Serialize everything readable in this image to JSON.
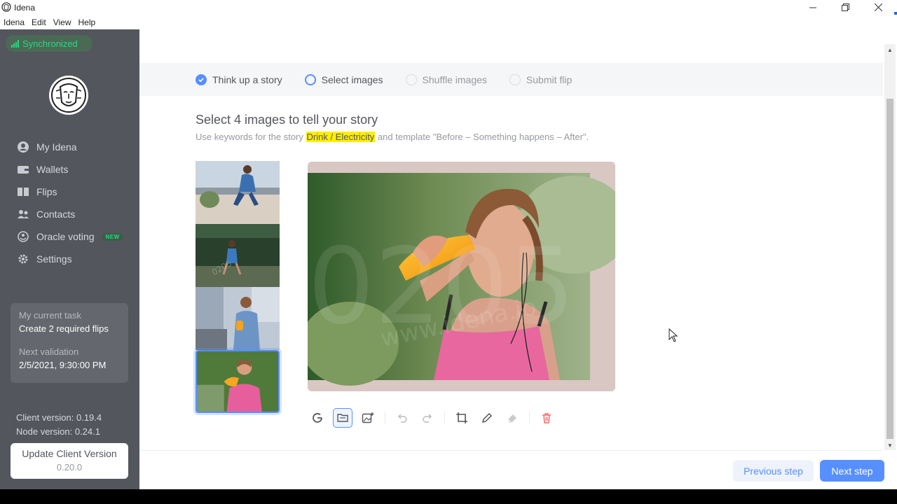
{
  "window": {
    "title": "Idena",
    "minimize_icon": "minimize-icon",
    "maximize_icon": "restore-icon",
    "close_icon": "close-icon"
  },
  "menubar": {
    "items": [
      "Idena",
      "Edit",
      "View",
      "Help"
    ]
  },
  "sidebar": {
    "sync_status": "Synchronized",
    "nav": [
      {
        "label": "My Idena",
        "icon": "user-icon"
      },
      {
        "label": "Wallets",
        "icon": "wallet-icon"
      },
      {
        "label": "Flips",
        "icon": "flips-icon"
      },
      {
        "label": "Contacts",
        "icon": "contacts-icon"
      },
      {
        "label": "Oracle voting",
        "icon": "oracle-icon",
        "badge": "NEW"
      },
      {
        "label": "Settings",
        "icon": "gear-icon"
      }
    ],
    "task": {
      "caption": "My current task",
      "value": "Create 2 required flips",
      "next_caption": "Next validation",
      "next_value": "2/5/2021, 9:30:00 PM"
    },
    "client_version": "Client version: 0.19.4",
    "node_version": "Node version: 0.24.1",
    "update_button": {
      "label": "Update Client Version",
      "version": "0.20.0"
    }
  },
  "steps": [
    {
      "label": "Think up a story",
      "state": "done"
    },
    {
      "label": "Select images",
      "state": "active"
    },
    {
      "label": "Shuffle images",
      "state": "todo"
    },
    {
      "label": "Submit flip",
      "state": "todo"
    }
  ],
  "main": {
    "heading": "Select 4 images to tell your story",
    "subtext_prefix": "Use keywords for the story",
    "keywords": "Drink / Electricity",
    "subtext_suffix": "and template \"Before – Something happens – After\".",
    "selected_thumb_index": 3,
    "watermark": "www.idena.io"
  },
  "toolbar": {
    "tools": [
      "google-search-icon",
      "folder-icon",
      "add-image-icon",
      "undo-icon",
      "redo-icon",
      "crop-icon",
      "pencil-icon",
      "eraser-icon",
      "delete-icon"
    ]
  },
  "footer": {
    "previous": "Previous step",
    "next": "Next step"
  },
  "colors": {
    "sidebar_bg": "#53565c",
    "accent": "#578fff",
    "sync_green": "#27d980",
    "highlight": "#ffee00",
    "delete_red": "#ff6666"
  }
}
